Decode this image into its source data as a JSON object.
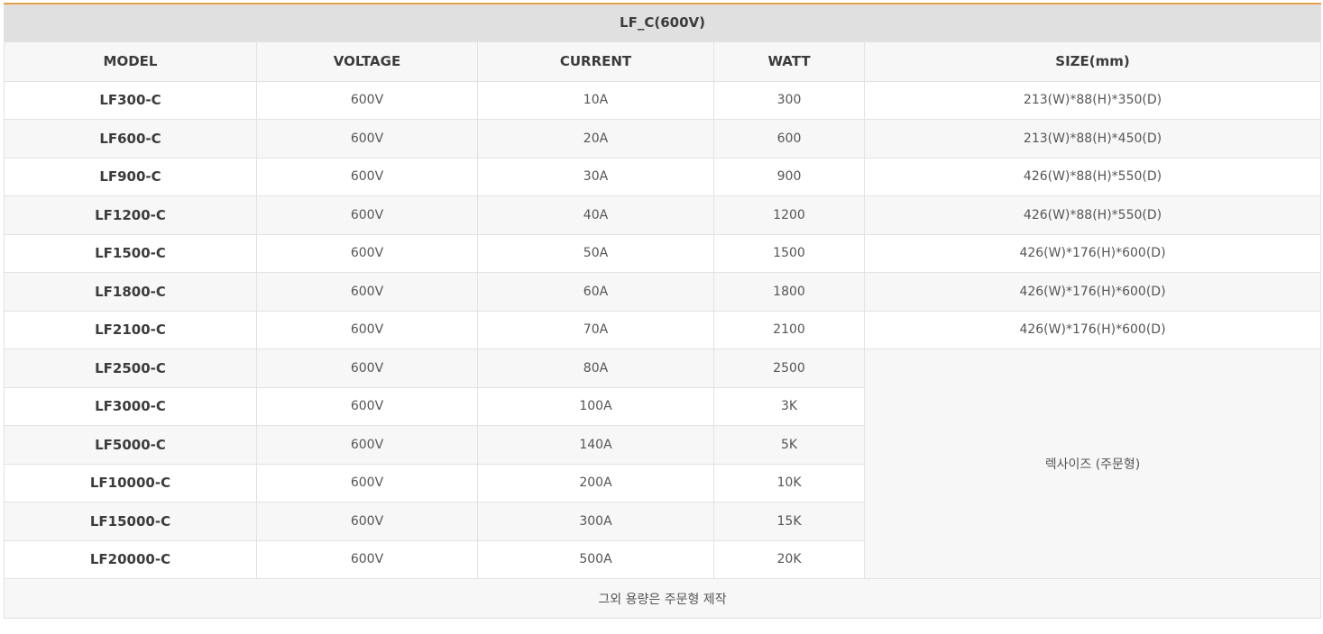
{
  "table": {
    "title": "LF_C(600V)",
    "headers": [
      "MODEL",
      "VOLTAGE",
      "CURRENT",
      "WATT",
      "SIZE(mm)"
    ],
    "rows": [
      {
        "model": "LF300-C",
        "voltage": "600V",
        "current": "10A",
        "watt": "300",
        "size": "213(W)*88(H)*350(D)"
      },
      {
        "model": "LF600-C",
        "voltage": "600V",
        "current": "20A",
        "watt": "600",
        "size": "213(W)*88(H)*450(D)"
      },
      {
        "model": "LF900-C",
        "voltage": "600V",
        "current": "30A",
        "watt": "900",
        "size": "426(W)*88(H)*550(D)"
      },
      {
        "model": "LF1200-C",
        "voltage": "600V",
        "current": "40A",
        "watt": "1200",
        "size": "426(W)*88(H)*550(D)"
      },
      {
        "model": "LF1500-C",
        "voltage": "600V",
        "current": "50A",
        "watt": "1500",
        "size": "426(W)*176(H)*600(D)"
      },
      {
        "model": "LF1800-C",
        "voltage": "600V",
        "current": "60A",
        "watt": "1800",
        "size": "426(W)*176(H)*600(D)"
      },
      {
        "model": "LF2100-C",
        "voltage": "600V",
        "current": "70A",
        "watt": "2100",
        "size": "426(W)*176(H)*600(D)"
      },
      {
        "model": "LF2500-C",
        "voltage": "600V",
        "current": "80A",
        "watt": "2500"
      },
      {
        "model": "LF3000-C",
        "voltage": "600V",
        "current": "100A",
        "watt": "3K"
      },
      {
        "model": "LF5000-C",
        "voltage": "600V",
        "current": "140A",
        "watt": "5K"
      },
      {
        "model": "LF10000-C",
        "voltage": "600V",
        "current": "200A",
        "watt": "10K"
      },
      {
        "model": "LF15000-C",
        "voltage": "600V",
        "current": "300A",
        "watt": "15K"
      },
      {
        "model": "LF20000-C",
        "voltage": "600V",
        "current": "500A",
        "watt": "20K"
      }
    ],
    "merged_size": "렉사이즈 (주문형)",
    "footer": "그외 용량은 주문형 제작"
  },
  "colors": {
    "accent_border": "#e5a24c",
    "title_bg": "#e0e0e0",
    "stripe_bg": "#f7f7f7"
  }
}
